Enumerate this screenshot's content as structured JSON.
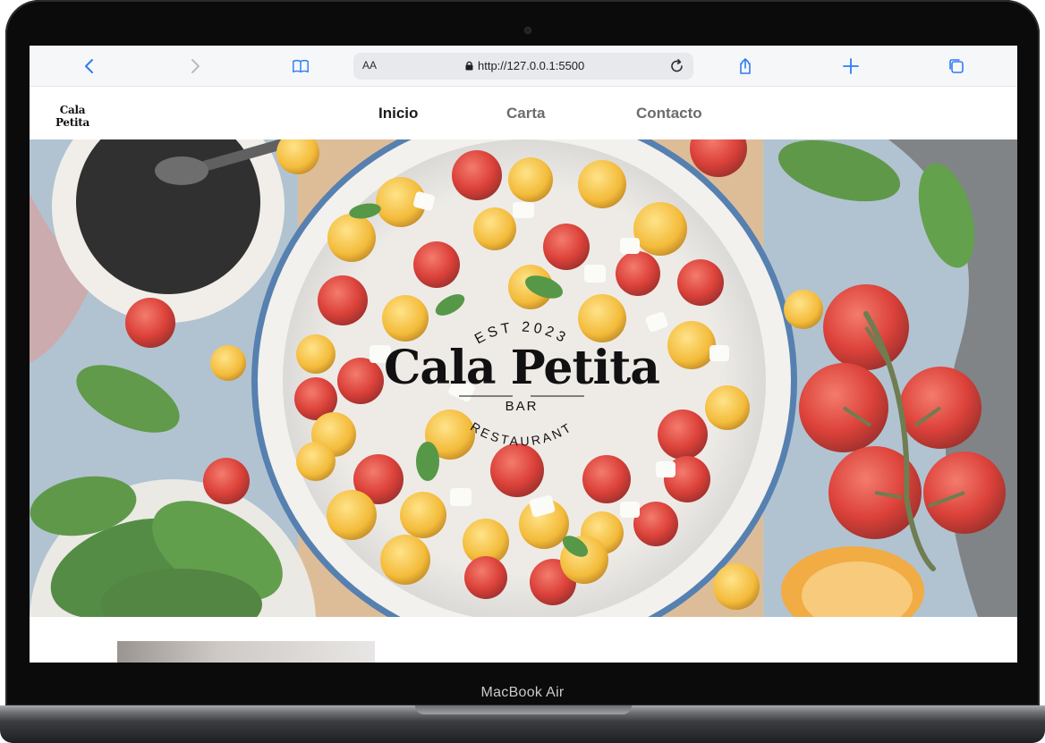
{
  "browser": {
    "aa_label": "AA",
    "url": "http://127.0.0.1:5500"
  },
  "site": {
    "logo_text": "Cala Petita",
    "nav": {
      "inicio": "Inicio",
      "carta": "Carta",
      "contacto": "Contacto"
    },
    "hero": {
      "est": "EST 2023",
      "title": "Cala Petita",
      "bar": "BAR",
      "restaurant": "RESTAURANT"
    }
  },
  "device": {
    "label": "MacBook Air"
  },
  "icons": {
    "back": "chevron-left-icon",
    "forward": "chevron-right-icon",
    "bookmarks": "book-icon",
    "lock": "lock-icon",
    "reload": "reload-icon",
    "share": "share-icon",
    "new_tab": "plus-icon",
    "tabs": "tabs-icon"
  },
  "colors": {
    "accent": "#2f7cf6",
    "nav_active": "#1b1b1b",
    "nav_muted": "#6c6c6c"
  }
}
